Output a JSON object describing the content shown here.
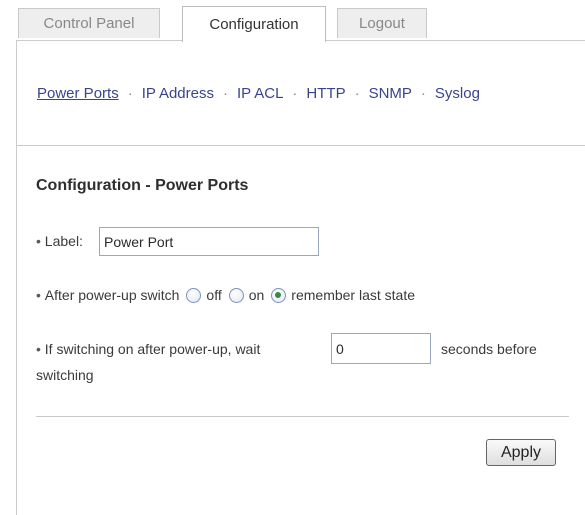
{
  "tabs": [
    {
      "label": "Control Panel",
      "active": false
    },
    {
      "label": "Configuration",
      "active": true
    },
    {
      "label": "Logout",
      "active": false
    }
  ],
  "subnav": {
    "separator": "·",
    "links": [
      "Power Ports",
      "IP Address",
      "IP ACL",
      "HTTP",
      "SNMP",
      "Syslog"
    ],
    "active": "Power Ports"
  },
  "section": {
    "title": "Configuration - Power Ports"
  },
  "form": {
    "bullet": "•",
    "label_field": {
      "label": "Label:",
      "value": "Power Port"
    },
    "power_up": {
      "label": "After power-up switch",
      "options": [
        "off",
        "on",
        "remember last state"
      ],
      "selected": "remember last state"
    },
    "wait": {
      "label_before": "If switching on after power-up, wait",
      "value": "0",
      "label_after": "seconds before",
      "label_wrap": "switching"
    }
  },
  "apply_button": {
    "label": "Apply"
  },
  "colors": {
    "link": "#39448f",
    "radio_checked": "#2f8f3a"
  }
}
